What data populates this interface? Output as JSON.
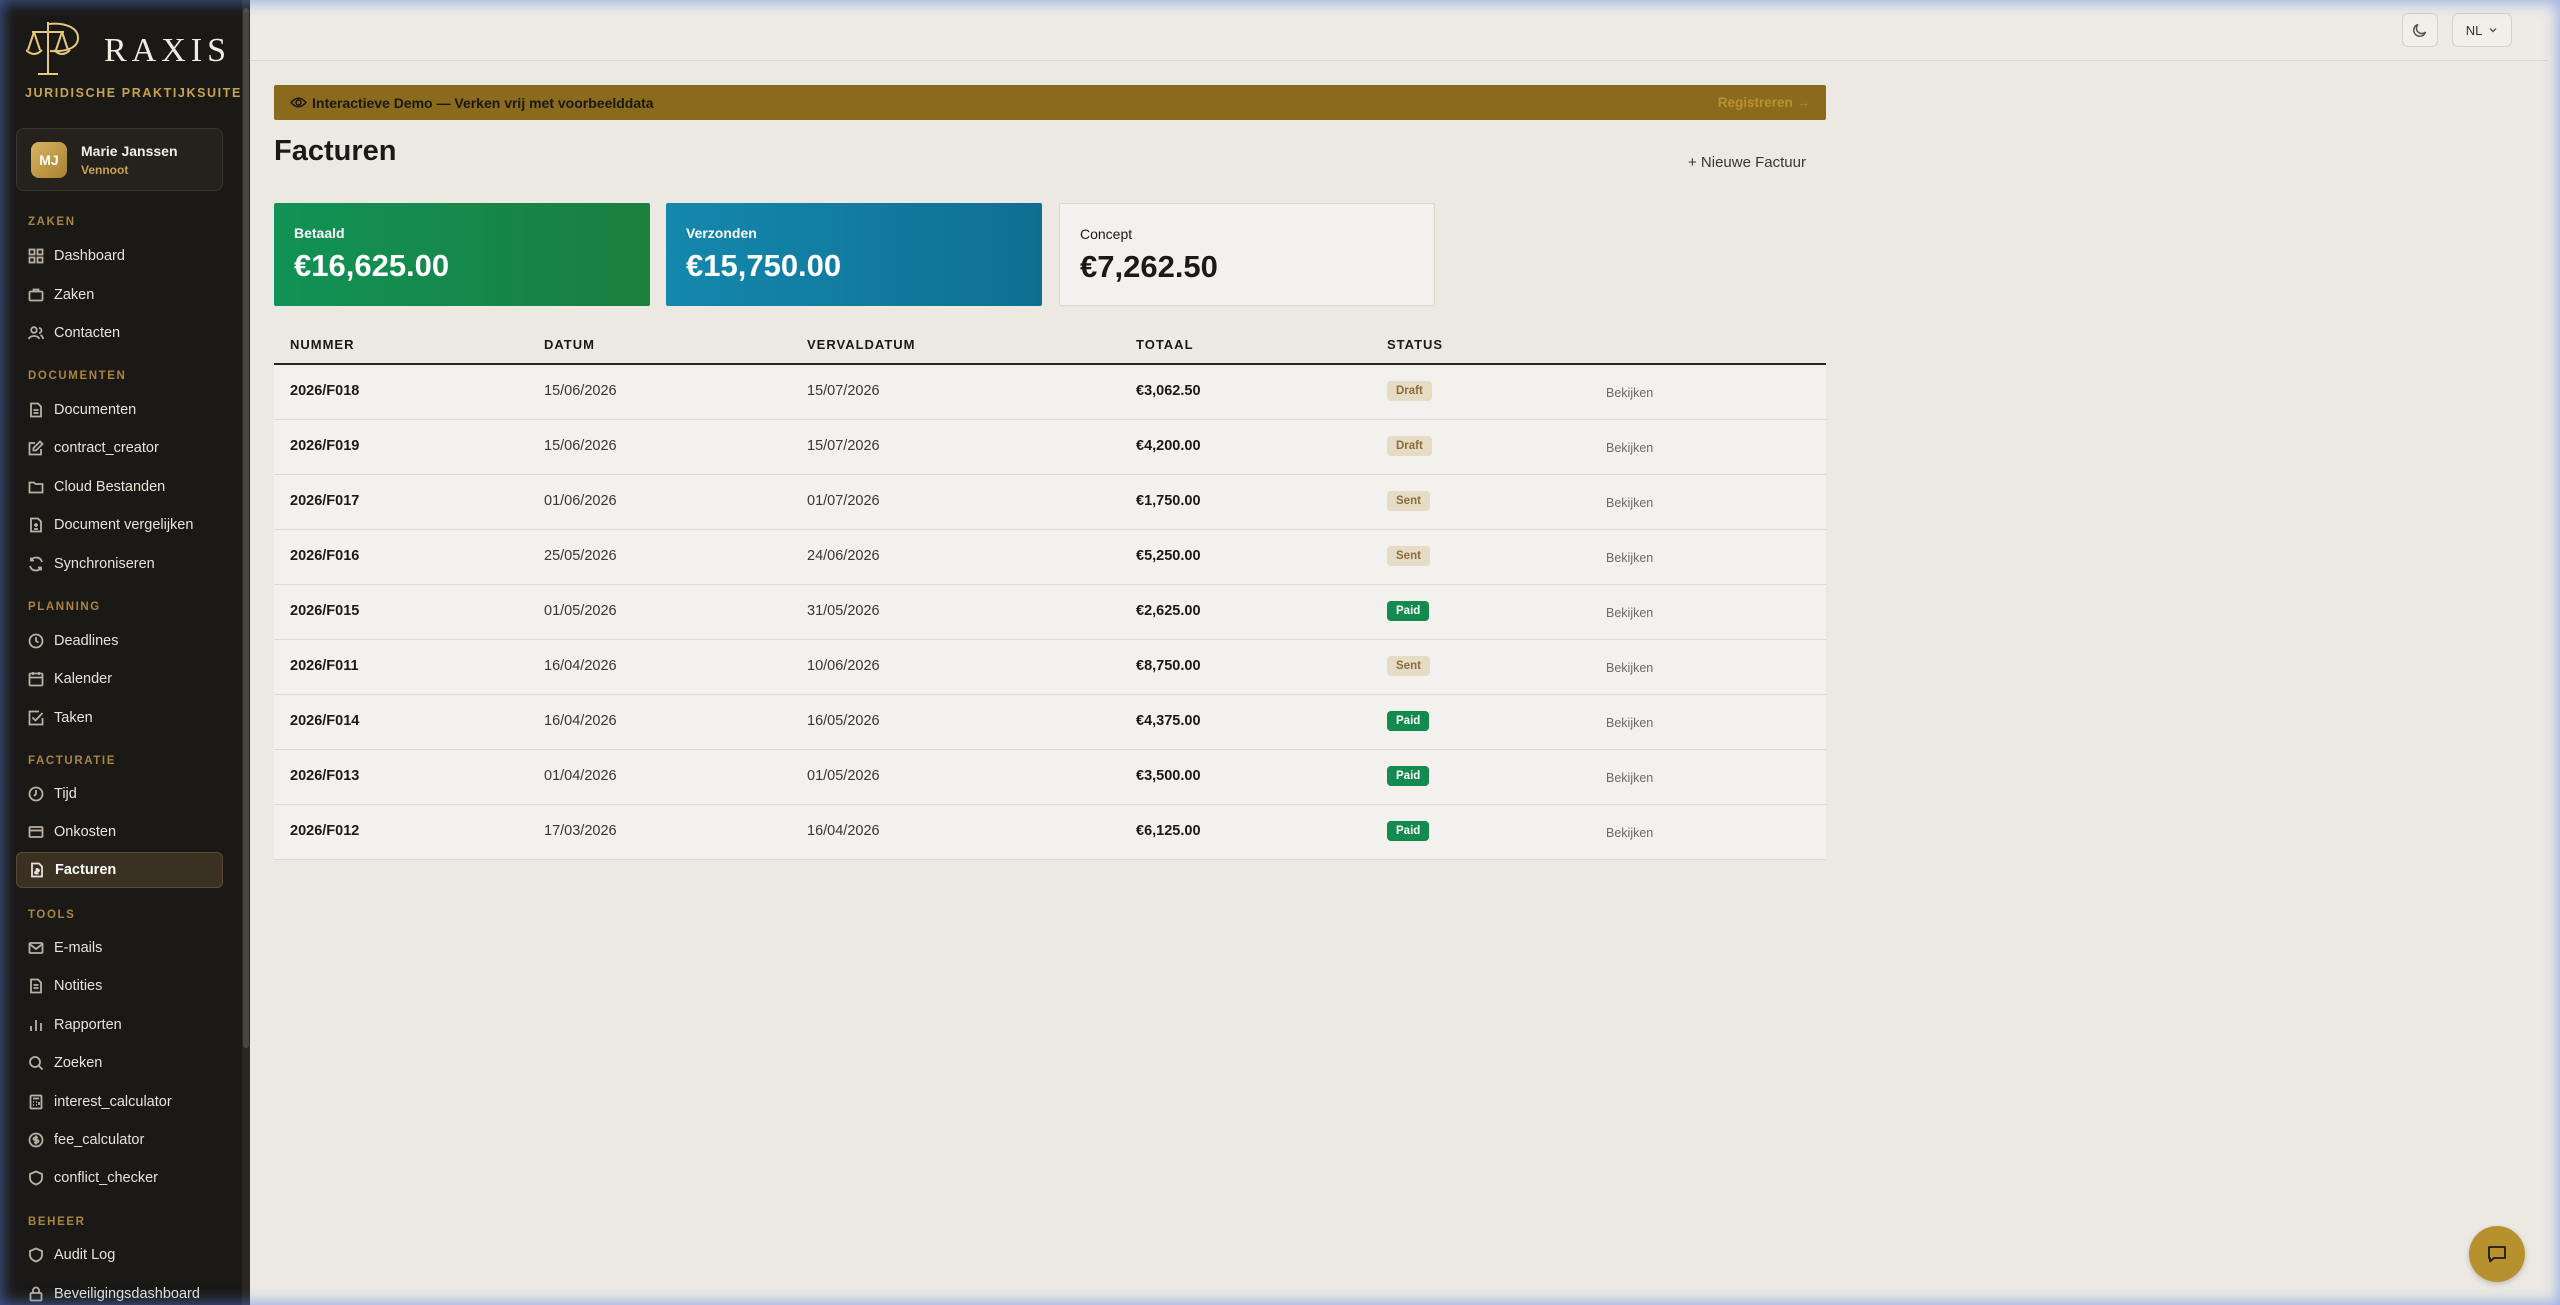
{
  "brand": {
    "name": "RAXIS",
    "tagline": "JURIDISCHE PRAKTIJKSUITE"
  },
  "user": {
    "initials": "MJ",
    "name": "Marie Janssen",
    "role": "Vennoot"
  },
  "nav": {
    "sections": {
      "zaken": "ZAKEN",
      "documenten": "DOCUMENTEN",
      "planning": "PLANNING",
      "facturatie": "FACTURATIE",
      "tools": "TOOLS",
      "beheer": "BEHEER"
    },
    "items": {
      "dashboard": "Dashboard",
      "zaken": "Zaken",
      "contacten": "Contacten",
      "documenten": "Documenten",
      "contract_creator": "contract_creator",
      "cloud": "Cloud Bestanden",
      "vergelijken": "Document vergelijken",
      "sync": "Synchroniseren",
      "deadlines": "Deadlines",
      "kalender": "Kalender",
      "taken": "Taken",
      "tijd": "Tijd",
      "onkosten": "Onkosten",
      "facturen": "Facturen",
      "emails": "E-mails",
      "notities": "Notities",
      "rapporten": "Rapporten",
      "zoeken": "Zoeken",
      "interest": "interest_calculator",
      "fee": "fee_calculator",
      "conflict": "conflict_checker",
      "audit": "Audit Log",
      "security": "Beveiligingsdashboard"
    },
    "active": "facturen"
  },
  "topbar": {
    "language": "NL"
  },
  "banner": {
    "text": "Interactieve Demo — Verken vrij met voorbeelddata",
    "link": "Registreren →"
  },
  "page": {
    "title": "Facturen",
    "new_button": "+ Nieuwe Factuur"
  },
  "summary": {
    "paid_label": "Betaald",
    "paid_value": "€16,625.00",
    "sent_label": "Verzonden",
    "sent_value": "€15,750.00",
    "draft_label": "Concept",
    "draft_value": "€7,262.50"
  },
  "colors": {
    "accent_gold": "#c9a24e",
    "paid_green": "#138a4e",
    "sent_blue": "#1488ad",
    "sidebar_bg": "#1b1916"
  },
  "table": {
    "headers": {
      "number": "NUMMER",
      "date": "DATUM",
      "due": "VERVALDATUM",
      "total": "TOTAAL",
      "status": "STATUS"
    },
    "view_label": "Bekijken",
    "rows": [
      {
        "number": "2026/F018",
        "date": "15/06/2026",
        "due": "15/07/2026",
        "total": "€3,062.50",
        "status": "Draft"
      },
      {
        "number": "2026/F019",
        "date": "15/06/2026",
        "due": "15/07/2026",
        "total": "€4,200.00",
        "status": "Draft"
      },
      {
        "number": "2026/F017",
        "date": "01/06/2026",
        "due": "01/07/2026",
        "total": "€1,750.00",
        "status": "Sent"
      },
      {
        "number": "2026/F016",
        "date": "25/05/2026",
        "due": "24/06/2026",
        "total": "€5,250.00",
        "status": "Sent"
      },
      {
        "number": "2026/F015",
        "date": "01/05/2026",
        "due": "31/05/2026",
        "total": "€2,625.00",
        "status": "Paid"
      },
      {
        "number": "2026/F011",
        "date": "16/04/2026",
        "due": "10/06/2026",
        "total": "€8,750.00",
        "status": "Sent"
      },
      {
        "number": "2026/F014",
        "date": "16/04/2026",
        "due": "16/05/2026",
        "total": "€4,375.00",
        "status": "Paid"
      },
      {
        "number": "2026/F013",
        "date": "01/04/2026",
        "due": "01/05/2026",
        "total": "€3,500.00",
        "status": "Paid"
      },
      {
        "number": "2026/F012",
        "date": "17/03/2026",
        "due": "16/04/2026",
        "total": "€6,125.00",
        "status": "Paid"
      }
    ]
  }
}
